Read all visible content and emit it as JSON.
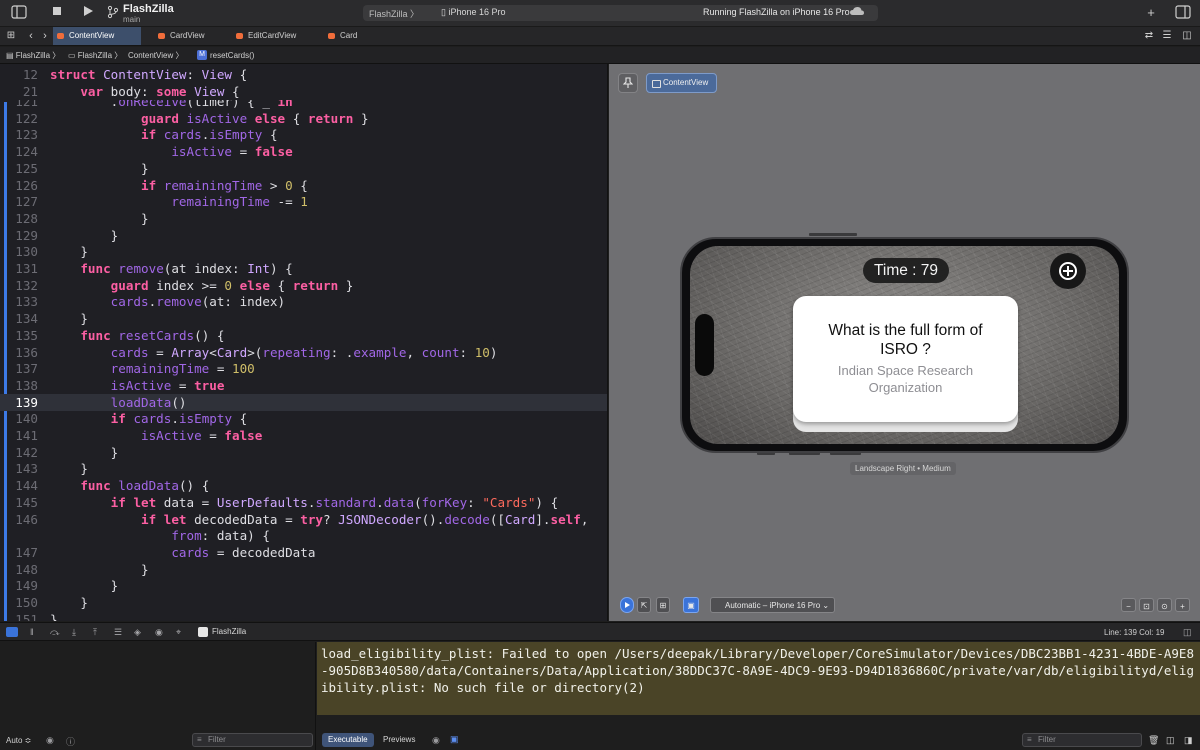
{
  "toolbar": {
    "scheme_title": "FlashZilla",
    "branch": "main",
    "activity_target": "FlashZilla",
    "activity_device": "iPhone 16 Pro",
    "activity_status": "Running FlashZilla on iPhone 16 Pro"
  },
  "tabs": [
    {
      "label": "ContentView",
      "active": true
    },
    {
      "label": "CardView",
      "active": false
    },
    {
      "label": "EditCardView",
      "active": false
    },
    {
      "label": "Card",
      "active": false
    }
  ],
  "breadcrumb": [
    "FlashZilla",
    "FlashZilla",
    "ContentView",
    "resetCards()"
  ],
  "breadcrumb_symbol_badge": "M",
  "editor": {
    "sticky": [
      {
        "n": "12",
        "html": "<span class='kw'>struct</span> <span class='ty'>ContentView</span>: <span class='ty'>View</span> {"
      },
      {
        "n": "21",
        "html": "    <span class='kw'>var</span> body: <span class='kw'>some</span> <span class='ty'>View</span> {"
      }
    ],
    "lines": [
      {
        "n": "121",
        "html": "        .<span class='fn'>onReceive</span>(timer) { _ <span class='kw'>in</span>"
      },
      {
        "n": "122",
        "html": "            <span class='kw'>guard</span> <span class='prm'>isActive</span> <span class='kw'>else</span> { <span class='kw'>return</span> }"
      },
      {
        "n": "123",
        "html": "            <span class='kw'>if</span> <span class='prm'>cards</span>.<span class='prm'>isEmpty</span> {"
      },
      {
        "n": "124",
        "html": "                <span class='prm'>isActive</span> = <span class='kw'>false</span>"
      },
      {
        "n": "125",
        "html": "            }"
      },
      {
        "n": "126",
        "html": "            <span class='kw'>if</span> <span class='prm'>remainingTime</span> &gt; <span class='num'>0</span> {"
      },
      {
        "n": "127",
        "html": "                <span class='prm'>remainingTime</span> -= <span class='num'>1</span>"
      },
      {
        "n": "128",
        "html": "            }"
      },
      {
        "n": "129",
        "html": "        }"
      },
      {
        "n": "130",
        "html": "    }"
      },
      {
        "n": "131",
        "html": "    <span class='kw'>func</span> <span class='fn'>remove</span>(at index: <span class='ty'>Int</span>) {"
      },
      {
        "n": "132",
        "html": "        <span class='kw'>guard</span> index &gt;= <span class='num'>0</span> <span class='kw'>else</span> { <span class='kw'>return</span> }"
      },
      {
        "n": "133",
        "html": "        <span class='prm'>cards</span>.<span class='fn'>remove</span>(at: index)"
      },
      {
        "n": "134",
        "html": "    }"
      },
      {
        "n": "135",
        "html": "    <span class='kw'>func</span> <span class='fn'>resetCards</span>() {"
      },
      {
        "n": "136",
        "html": "        <span class='prm'>cards</span> = <span class='ty'>Array</span>&lt;<span class='ty'>Card</span>&gt;(<span class='prm'>repeating</span>: .<span class='prm'>example</span>, <span class='prm'>count</span>: <span class='num'>10</span>)"
      },
      {
        "n": "137",
        "html": "        <span class='prm'>remainingTime</span> = <span class='num'>100</span>"
      },
      {
        "n": "138",
        "html": "        <span class='prm'>isActive</span> = <span class='kw'>true</span>"
      },
      {
        "n": "139",
        "html": "        <span class='fn'>loadData</span>()",
        "highlight": true
      },
      {
        "n": "140",
        "html": "        <span class='kw'>if</span> <span class='prm'>cards</span>.<span class='prm'>isEmpty</span> {"
      },
      {
        "n": "141",
        "html": "            <span class='prm'>isActive</span> = <span class='kw'>false</span>"
      },
      {
        "n": "142",
        "html": "        }"
      },
      {
        "n": "143",
        "html": "    }"
      },
      {
        "n": "144",
        "html": "    <span class='kw'>func</span> <span class='fn'>loadData</span>() {"
      },
      {
        "n": "145",
        "html": "        <span class='kw'>if</span> <span class='kw'>let</span> data = <span class='ty'>UserDefaults</span>.<span class='prm'>standard</span>.<span class='fn'>data</span>(<span class='prm'>forKey</span>: <span class='str'>\"Cards\"</span>) {"
      },
      {
        "n": "146",
        "html": "            <span class='kw'>if</span> <span class='kw'>let</span> decodedData = <span class='kw'>try</span>? <span class='ty'>JSONDecoder</span>().<span class='fn'>decode</span>([<span class='ty'>Card</span>].<span class='kw'>self</span>,"
      },
      {
        "n": "",
        "html": "                <span class='prm'>from</span>: data) {"
      },
      {
        "n": "147",
        "html": "                <span class='prm'>cards</span> = decodedData"
      },
      {
        "n": "148",
        "html": "            }"
      },
      {
        "n": "149",
        "html": "        }"
      },
      {
        "n": "150",
        "html": "    }"
      },
      {
        "n": "151",
        "html": "}"
      }
    ]
  },
  "preview": {
    "chip_label": "ContentView",
    "timer_text": "Time : 79",
    "card_question": "What is the full form of ISRO ?",
    "card_answer": "Indian Space Research Organization",
    "orientation_label": "Landscape Right • Medium",
    "device_selector": "Automatic – iPhone 16 Pro"
  },
  "debugbar": {
    "target_label": "FlashZilla",
    "cursor_position": "Line: 139  Col: 19"
  },
  "console": {
    "message": "load_eligibility_plist: Failed to open /Users/deepak/Library/Developer/CoreSimulator/Devices/DBC23BB1-4231-4BDE-A9E8-905D8B340580/data/Containers/Data/Application/38DDC37C-8A9E-4DC9-9E93-D94D1836860C/private/var/db/eligibilityd/eligibility.plist: No such file or directory(2)",
    "filter_placeholder": "Filter",
    "segments": [
      {
        "label": "Executable",
        "active": true
      },
      {
        "label": "Previews",
        "active": false
      }
    ]
  },
  "varpane": {
    "scope_label": "Auto ≎",
    "filter_placeholder": "Filter"
  }
}
